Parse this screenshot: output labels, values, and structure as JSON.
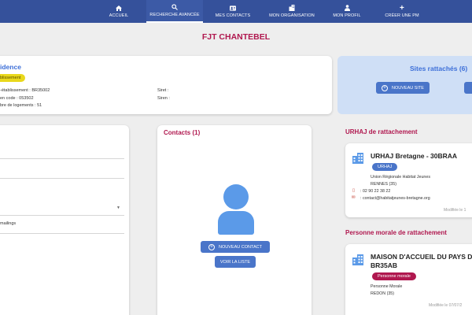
{
  "nav": {
    "items": [
      {
        "label": "ACCUEIL",
        "icon": "home-icon"
      },
      {
        "label": "RECHERCHE AVANCÉE",
        "icon": "search-icon"
      },
      {
        "label": "MES CONTACTS",
        "icon": "contact-card-icon"
      },
      {
        "label": "MON ORGANISATION",
        "icon": "building-icon"
      },
      {
        "label": "MON PROFIL",
        "icon": "user-icon"
      },
      {
        "label": "CRÉER UNE PM",
        "icon": "plus-icon"
      }
    ],
    "active_index": 1
  },
  "page": {
    "title": "FJT CHANTEBEL"
  },
  "residence": {
    "title": "idence",
    "badge": "blissement",
    "etablissement": "-établissement : BR35002",
    "code": "en code : 053502",
    "logements": "bre de logements : 51",
    "siret": "Siret :",
    "siren": "Siren :"
  },
  "sites": {
    "title": "Sites rattachés (6)",
    "new_site_label": "NOUVEAU SITE"
  },
  "left_form": {
    "mailings": "mailings"
  },
  "contacts": {
    "title": "Contacts (1)",
    "new_contact_label": "NOUVEAU CONTACT",
    "view_list_label": "VOIR LA LISTE"
  },
  "urhaj": {
    "section_title": "URHAJ de rattachement",
    "name": "URHAJ Bretagne - 30BRAA",
    "badge": "URHAJ",
    "full_name": "Union Régionale Habitat Jeunes",
    "city": "RENNES (35)",
    "phone": ": 02 90 22 38 22",
    "email": ": contact@habitatjeunes-bretagne.org",
    "modified": "Modifiée le 1"
  },
  "pm": {
    "section_title": "Personne morale de rattachement",
    "name_line1": "MAISON D'ACCUEIL DU PAYS D",
    "name_line2": "BR35AB",
    "badge": "Personne morale",
    "type": "Personne Morale",
    "city": "REDON (35)",
    "modified": "Modifiée le 07/07/2"
  },
  "colors": {
    "nav": "#35519b",
    "accent_red": "#b0184f",
    "accent_blue": "#3d6fd8",
    "button_blue": "#4a75c9",
    "badge_yellow": "#e9d81c",
    "sites_bg": "#cfdff6"
  }
}
